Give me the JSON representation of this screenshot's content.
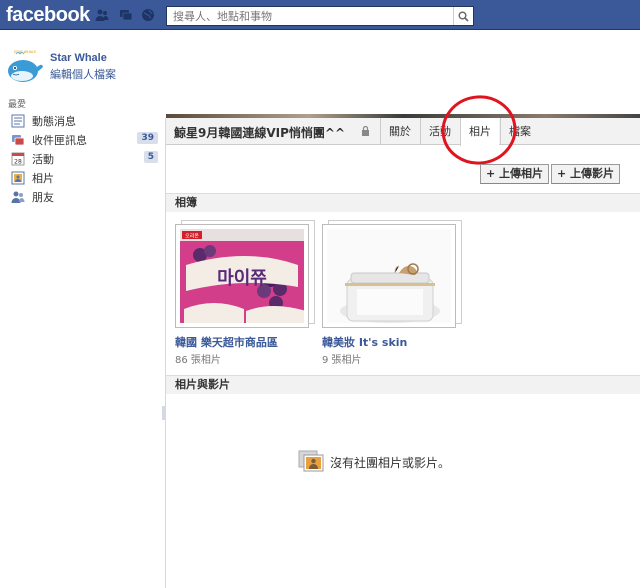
{
  "topbar": {
    "logo": "facebook",
    "search_placeholder": "搜尋人、地點和事物"
  },
  "profile": {
    "name": "Star Whale",
    "edit_label": "編輯個人檔案",
    "avatar_caption": "STAR WHALE"
  },
  "sidebar": {
    "header": "最愛",
    "items": [
      {
        "label": "動態消息",
        "icon": "news-feed-icon"
      },
      {
        "label": "收件匣訊息",
        "icon": "messages-icon",
        "count": "39"
      },
      {
        "label": "活動",
        "icon": "events-icon",
        "count": "5",
        "icon_text": "28"
      },
      {
        "label": "相片",
        "icon": "photos-icon"
      },
      {
        "label": "朋友",
        "icon": "friends-icon"
      }
    ]
  },
  "group": {
    "title": "鯨星9月韓國連線VIP悄悄團^^",
    "tabs": [
      "關於",
      "活動",
      "相片",
      "檔案"
    ],
    "active_tab": "相片"
  },
  "uploads": {
    "photo_label": "+ 上傳相片",
    "video_label": "+ 上傳影片"
  },
  "albums_section": {
    "header": "相簿",
    "albums": [
      {
        "title": "韓國 樂天超市商品區",
        "count": "86 張相片",
        "product_text": "마이쮸",
        "brand_text": "오리온"
      },
      {
        "title": "韓美妝 It's skin",
        "count": "9 張相片"
      }
    ]
  },
  "media_section": {
    "header": "相片與影片",
    "empty_text": "沒有社團相片或影片。"
  },
  "colors": {
    "brand_blue": "#3b5998",
    "annotation_red": "#e0141e"
  }
}
